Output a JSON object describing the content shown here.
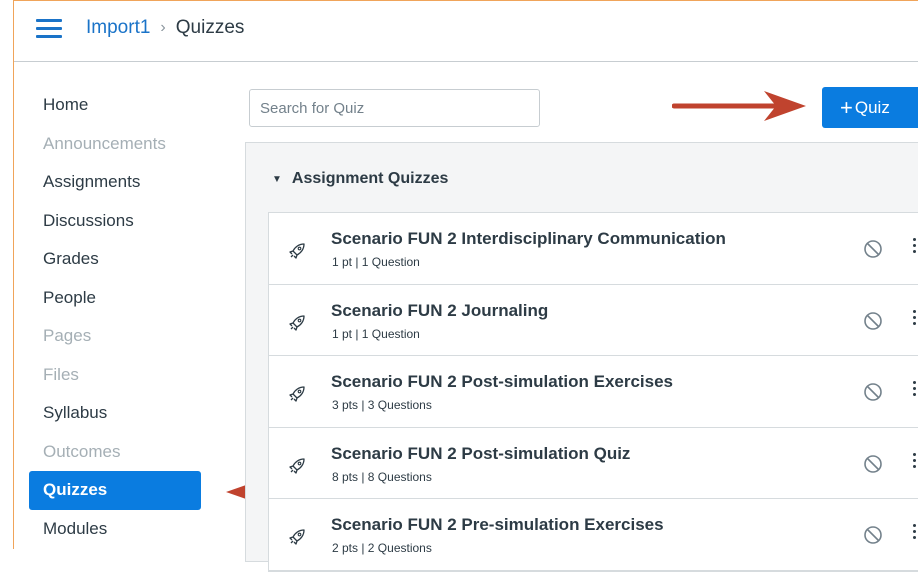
{
  "header": {
    "course": "Import1",
    "separator": "›",
    "current": "Quizzes"
  },
  "nav": {
    "items": [
      {
        "label": "Home",
        "state": "enabled"
      },
      {
        "label": "Announcements",
        "state": "disabled"
      },
      {
        "label": "Assignments",
        "state": "enabled"
      },
      {
        "label": "Discussions",
        "state": "enabled"
      },
      {
        "label": "Grades",
        "state": "enabled"
      },
      {
        "label": "People",
        "state": "enabled"
      },
      {
        "label": "Pages",
        "state": "disabled"
      },
      {
        "label": "Files",
        "state": "disabled"
      },
      {
        "label": "Syllabus",
        "state": "enabled"
      },
      {
        "label": "Outcomes",
        "state": "disabled"
      },
      {
        "label": "Quizzes",
        "state": "active"
      },
      {
        "label": "Modules",
        "state": "enabled"
      }
    ]
  },
  "search": {
    "placeholder": "Search for Quiz"
  },
  "add_button": {
    "plus": "+",
    "label": "Quiz"
  },
  "group": {
    "caret": "▼",
    "title": "Assignment Quizzes"
  },
  "quizzes": [
    {
      "title": "Scenario FUN 2 Interdisciplinary Communication",
      "meta": "1 pt | 1 Question"
    },
    {
      "title": "Scenario FUN 2 Journaling",
      "meta": "1 pt | 1 Question"
    },
    {
      "title": "Scenario FUN 2 Post-simulation Exercises",
      "meta": "3 pts | 3 Questions"
    },
    {
      "title": "Scenario FUN 2 Post-simulation Quiz",
      "meta": "8 pts | 8 Questions"
    },
    {
      "title": "Scenario FUN 2 Pre-simulation Exercises",
      "meta": "2 pts | 2 Questions"
    }
  ],
  "icons": {
    "menu": "hamburger-icon",
    "quiz": "rocket-icon",
    "publish": "unpublished-icon",
    "more": "kebab-icon"
  },
  "colors": {
    "accent": "#0a7ce0",
    "link": "#1a73c8",
    "annotation_arrow": "#c0432e",
    "text": "#2d3b45",
    "disabled": "#a5afb5"
  }
}
